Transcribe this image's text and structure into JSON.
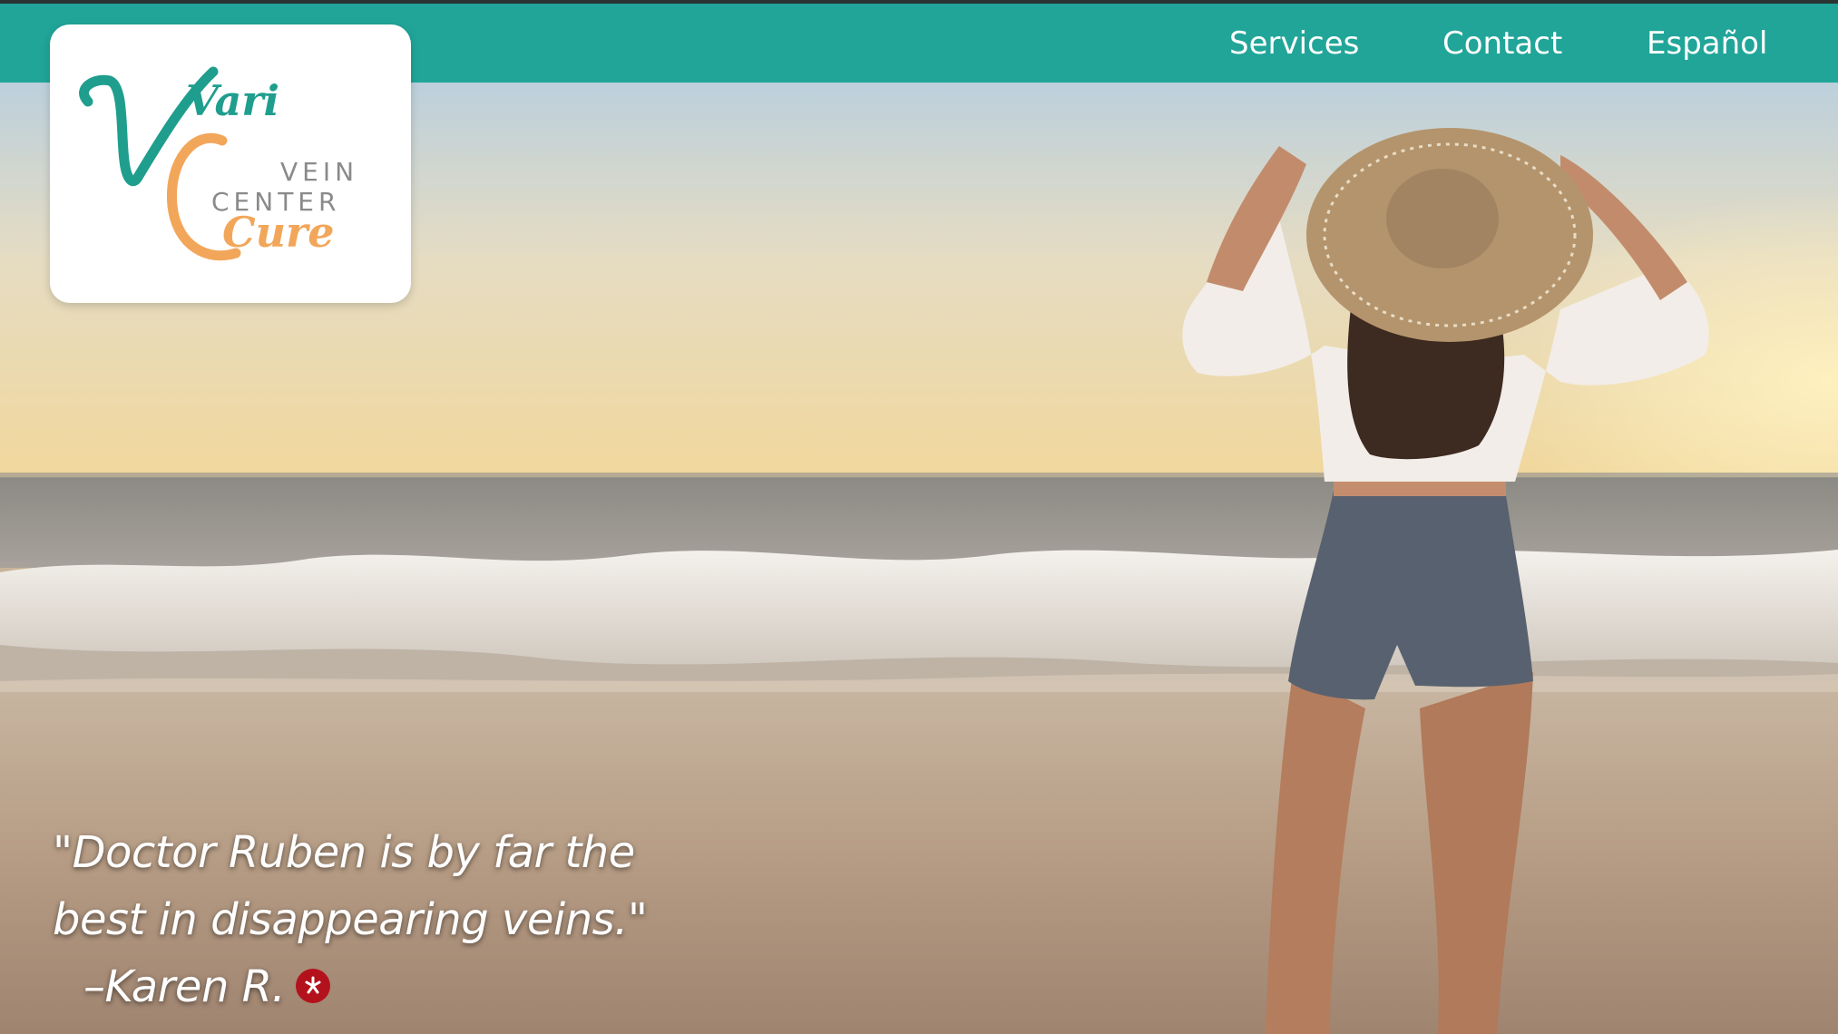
{
  "header": {
    "logo": {
      "wordmark_top": "Vari",
      "wordmark_bottom": "Cure",
      "tagline_top": "VEIN",
      "tagline_bottom": "CENTER"
    },
    "nav": [
      {
        "label": "Services"
      },
      {
        "label": "Contact"
      },
      {
        "label": "Español"
      }
    ]
  },
  "hero": {
    "quote_line1": "\"Doctor Ruben is by far the",
    "quote_line2": "best in disappearing veins.\"",
    "quote_author": "–Karen R.",
    "review_icon": "yelp-icon"
  },
  "colors": {
    "nav_bar": "#21a599",
    "brand_teal": "#1f9e8e",
    "brand_orange": "#f2a65a",
    "yelp_red": "#b3121c"
  }
}
